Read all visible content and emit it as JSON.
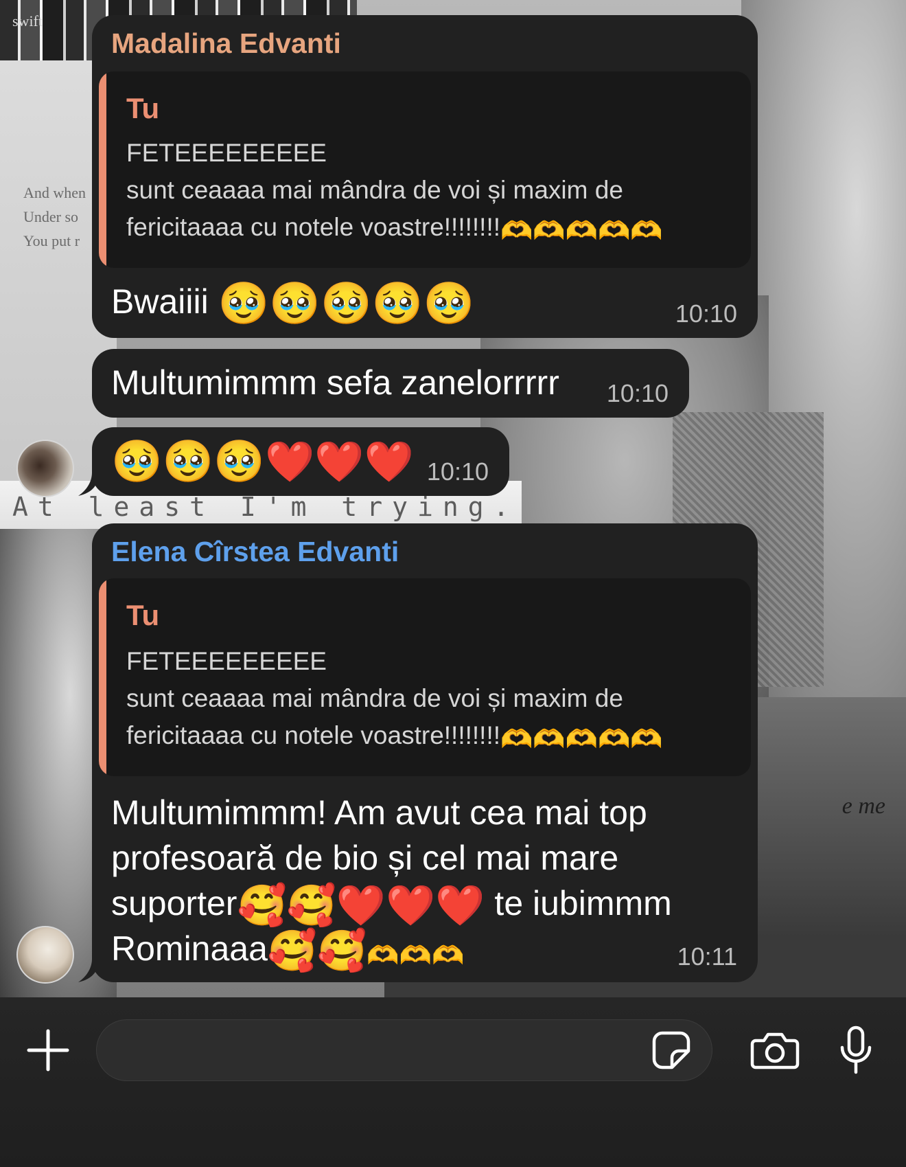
{
  "wallpaper": {
    "book_spine_word": "swift",
    "poem_lines": [
      "And when",
      "Under so",
      "You put r"
    ],
    "strip_text": "At least I'm trying.",
    "italic_text": "e me"
  },
  "messages": [
    {
      "sender": "Madalina Edvanti",
      "sender_color": "#e7a57f",
      "reply": {
        "author": "Tu",
        "lines": [
          "FETEEEEEEEEE",
          "sunt ceaaaa mai mândra de voi și maxim de",
          "fericitaaaa cu notele voastre!!!!!!!!"
        ],
        "trailing_emoji": "🫶🫶🫶🫶🫶"
      },
      "text": "Bwaiiii",
      "emoji": "🥹🥹🥹🥹🥹",
      "time": "10:10"
    },
    {
      "text": "Multumimmm sefa zanelorrrrr",
      "time": "10:10"
    },
    {
      "emoji_a": "🥹🥹🥹",
      "emoji_b": "❤️❤️❤️",
      "time": "10:10"
    },
    {
      "sender": "Elena Cîrstea Edvanti",
      "sender_color": "#5ea0ec",
      "reply": {
        "author": "Tu",
        "lines": [
          "FETEEEEEEEEE",
          "sunt ceaaaa mai mândra de voi și maxim de",
          "fericitaaaa cu notele voastre!!!!!!!!"
        ],
        "trailing_emoji": "🫶🫶🫶🫶🫶"
      },
      "lines": {
        "l1": "Multumimmm! Am avut cea mai top",
        "l2": "profesoară de bio și cel mai mare",
        "l3_text": "suporter",
        "l3_emoji_love": "🥰🥰",
        "l3_emoji_hearts": "❤️❤️❤️",
        "l3_tail": " te iubimmm",
        "l4_text": "Rominaaa",
        "l4_emoji_love": "🥰🥰",
        "l4_emoji_hands": "🫶🫶🫶"
      },
      "time": "10:11"
    }
  ],
  "composer": {
    "placeholder": "",
    "icons": [
      "plus-icon",
      "sticker-icon",
      "camera-icon",
      "microphone-icon"
    ]
  },
  "colors": {
    "bubble": "#212121",
    "reply_accent": "#eb8f72"
  }
}
